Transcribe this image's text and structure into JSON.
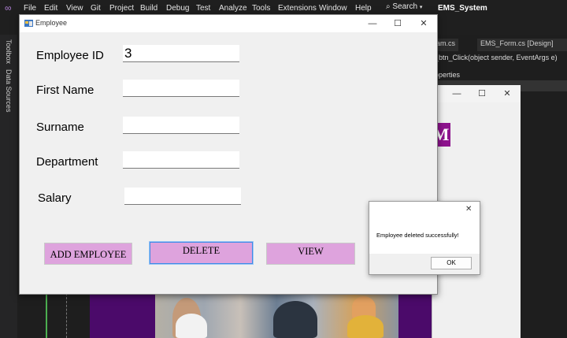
{
  "vs": {
    "menu": [
      "File",
      "Edit",
      "View",
      "Git",
      "Project",
      "Build",
      "Debug",
      "Test",
      "Analyze",
      "Tools",
      "Extensions",
      "Window",
      "Help"
    ],
    "search_label": "Search",
    "project_name": "EMS_System",
    "side_tabs": [
      "Toolbox",
      "Data Sources"
    ],
    "editor_tabs": [
      "am.cs",
      "EMS_Form.cs [Design]"
    ],
    "code_line": "_btn_Click(object sender, EventArgs e)",
    "properties_label": "operties",
    "banner_letter": "M"
  },
  "employee_form": {
    "title": "Employee",
    "fields": [
      {
        "label": "Employee ID",
        "value": "3"
      },
      {
        "label": "First Name",
        "value": ""
      },
      {
        "label": "Surname",
        "value": ""
      },
      {
        "label": "Department",
        "value": ""
      },
      {
        "label": "Salary",
        "value": ""
      }
    ],
    "buttons": {
      "add": "ADD EMPLOYEE",
      "delete": "DELETE",
      "view": "VIEW"
    }
  },
  "message_box": {
    "message": "Employee deleted successfully!",
    "ok_label": "OK"
  },
  "colors": {
    "button_fill": "#dea3dd",
    "form_bg": "#f0f0f0",
    "vs_dark": "#1f1f1f",
    "banner": "#8e138e"
  }
}
